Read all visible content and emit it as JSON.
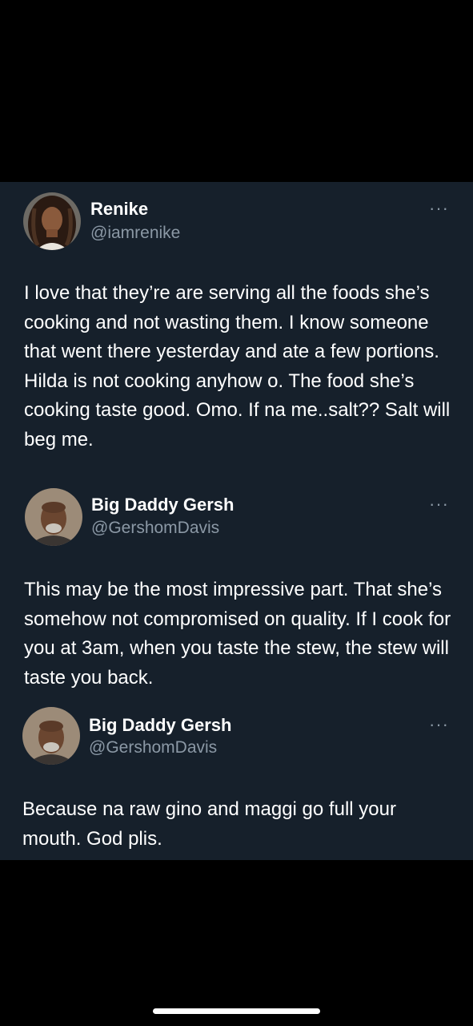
{
  "tweets": [
    {
      "display_name": "Renike",
      "handle": "@iamrenike",
      "more_label": "···",
      "text": "I love that they’re are serving all the foods she’s cooking and not wasting them. I know someone that went there yesterday and ate a few portions. Hilda is not cooking anyhow o. The food she’s cooking taste good. Omo. If na me..salt?? Salt will beg me."
    },
    {
      "display_name": "Big Daddy Gersh",
      "handle": "@GershomDavis",
      "more_label": "···",
      "text": "This may be the most impressive part. That she’s somehow not compromised on quality. If I cook for you at 3am, when you taste the stew, the stew will taste you back."
    },
    {
      "display_name": "Big Daddy Gersh",
      "handle": "@GershomDavis",
      "more_label": "···",
      "text": "Because na raw gino and maggi go full your mouth. God plis."
    }
  ],
  "colors": {
    "page_background": "#000000",
    "panel_background": "#16202b",
    "primary_text": "#ffffff",
    "secondary_text": "#8b98a5"
  }
}
